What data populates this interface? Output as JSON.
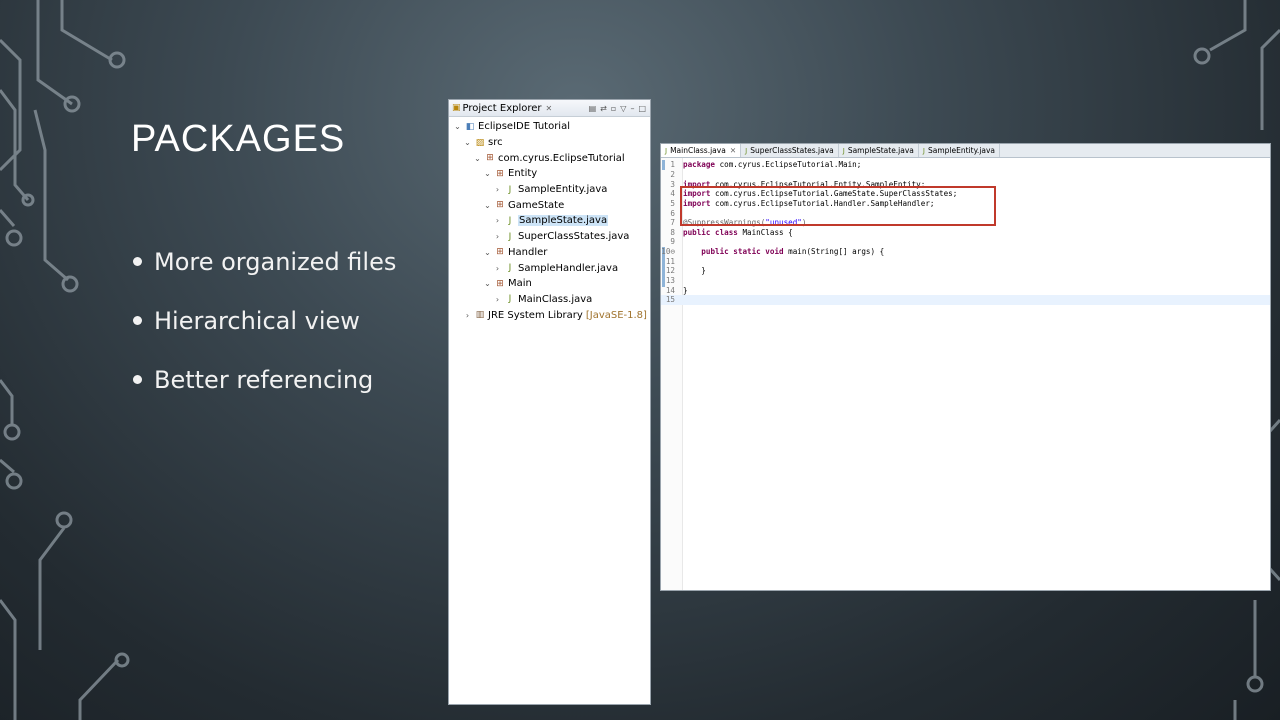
{
  "slide": {
    "title": "PACKAGES",
    "bullets": [
      "More organized files",
      "Hierarchical view",
      "Better referencing"
    ]
  },
  "project_explorer": {
    "tab_label": "Project Explorer",
    "tree": [
      {
        "label": "EclipseIDE Tutorial",
        "icon": "project-icon",
        "expanded": true
      },
      {
        "label": "src",
        "icon": "source-folder-icon",
        "expanded": true
      },
      {
        "label": "com.cyrus.EclipseTutorial",
        "icon": "package-icon",
        "expanded": true
      },
      {
        "label": "Entity",
        "icon": "package-icon",
        "expanded": true
      },
      {
        "label": "SampleEntity.java",
        "icon": "java-file-icon",
        "expanded": false
      },
      {
        "label": "GameState",
        "icon": "package-icon",
        "expanded": true
      },
      {
        "label": "SampleState.java",
        "icon": "java-file-icon",
        "expanded": false,
        "selected": true
      },
      {
        "label": "SuperClassStates.java",
        "icon": "java-file-icon",
        "expanded": false
      },
      {
        "label": "Handler",
        "icon": "package-icon",
        "expanded": true
      },
      {
        "label": "SampleHandler.java",
        "icon": "java-file-icon",
        "expanded": false
      },
      {
        "label": "Main",
        "icon": "package-icon",
        "expanded": true
      },
      {
        "label": "MainClass.java",
        "icon": "java-file-icon",
        "expanded": false
      },
      {
        "label": "JRE System Library",
        "suffix": "[JavaSE-1.8]",
        "icon": "library-icon",
        "expanded": false
      }
    ]
  },
  "editor": {
    "tabs": [
      {
        "label": "MainClass.java",
        "active": true
      },
      {
        "label": "SuperClassStates.java",
        "active": false
      },
      {
        "label": "SampleState.java",
        "active": false
      },
      {
        "label": "SampleEntity.java",
        "active": false
      }
    ],
    "line_numbers": [
      "1",
      "2",
      "3",
      "4",
      "5",
      "6",
      "7",
      "8",
      "9",
      "10⊖",
      "11",
      "12",
      "13",
      "14",
      "15"
    ],
    "lines": [
      {
        "kw": "package",
        "text": " com.cyrus.EclipseTutorial.Main;"
      },
      {
        "kw": "",
        "text": ""
      },
      {
        "kw": "import",
        "text": " com.cyrus.EclipseTutorial.Entity.SampleEntity;"
      },
      {
        "kw": "import",
        "text": " com.cyrus.EclipseTutorial.GameState.SuperClassStates;"
      },
      {
        "kw": "import",
        "text": " com.cyrus.EclipseTutorial.Handler.SampleHandler;"
      },
      {
        "kw": "",
        "text": ""
      },
      {
        "annotation": "@SuppressWarnings(",
        "string": "\"unused\"",
        "close": ")"
      },
      {
        "kw": "public class",
        "text": " MainClass {"
      },
      {
        "kw": "",
        "text": ""
      },
      {
        "indent": "    ",
        "kw": "public static void",
        "text": " main(String[] args) {"
      },
      {
        "kw": "",
        "text": ""
      },
      {
        "kw": "",
        "text": "    }"
      },
      {
        "kw": "",
        "text": ""
      },
      {
        "kw": "",
        "text": "}"
      },
      {
        "kw": "",
        "text": ""
      }
    ]
  }
}
